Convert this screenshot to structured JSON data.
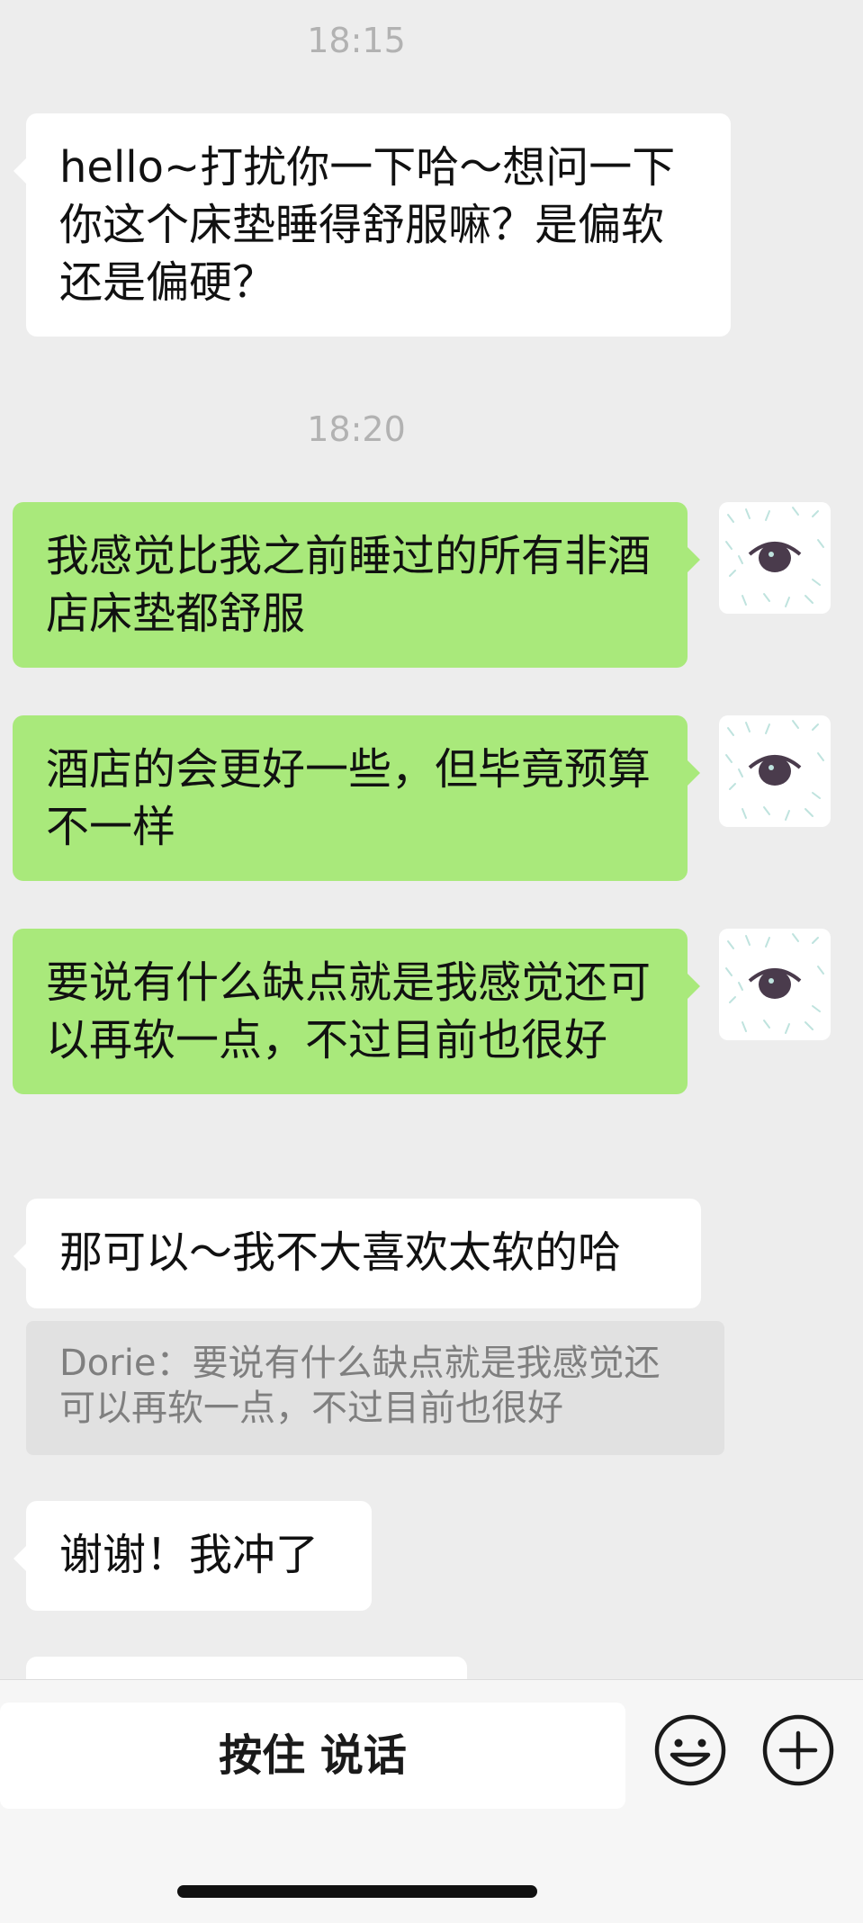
{
  "chat": {
    "time1": "18:15",
    "msg1": "hello~打扰你一下哈～想问一下你这个床垫睡得舒服嘛？是偏软还是偏硬？",
    "time2": "18:20",
    "msg2": "我感觉比我之前睡过的所有非酒店床垫都舒服",
    "msg3": "酒店的会更好一些，但毕竟预算不一样",
    "msg4": "要说有什么缺点就是我感觉还可以再软一点，不过目前也很好",
    "msg5": "那可以～我不大喜欢太软的哈",
    "quote5": "Dorie：要说有什么缺点就是我感觉还可以再软一点，不过目前也很好",
    "msg6": "谢谢！我冲了"
  },
  "bottombar": {
    "hold_to_talk": "按住 说话",
    "emoji_icon": "smile-face-icon",
    "more_icon": "plus-circle-icon"
  },
  "colors": {
    "background": "#ededed",
    "sent_bubble": "#a9e97b",
    "received_bubble": "#ffffff",
    "quote_bg": "#e1e1e1"
  }
}
